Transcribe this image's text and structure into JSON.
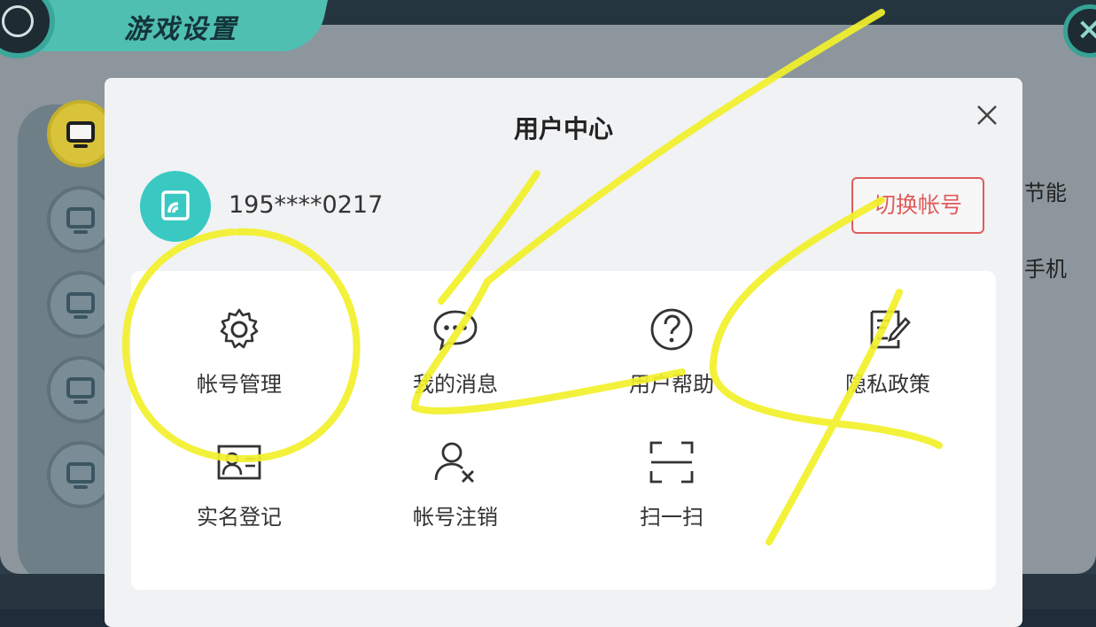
{
  "game": {
    "title": "游戏设置",
    "bg_right_texts": [
      "节能",
      "手机"
    ]
  },
  "modal": {
    "title": "用户中心",
    "close_icon": "close-icon",
    "user": {
      "avatar_icon": "app-logo-icon",
      "phone": "195****0217"
    },
    "switch_account_label": "切换帐号",
    "items": [
      {
        "label": "帐号管理",
        "icon": "gear-icon"
      },
      {
        "label": "我的消息",
        "icon": "chat-bubble-icon"
      },
      {
        "label": "用户帮助",
        "icon": "help-circle-icon"
      },
      {
        "label": "隐私政策",
        "icon": "document-edit-icon"
      },
      {
        "label": "实名登记",
        "icon": "id-card-icon"
      },
      {
        "label": "帐号注销",
        "icon": "user-remove-icon"
      },
      {
        "label": "扫一扫",
        "icon": "scan-icon"
      }
    ]
  },
  "colors": {
    "accent_teal": "#39c9c2",
    "danger_red": "#e05c5c",
    "annotation_yellow": "#f2f02a"
  }
}
